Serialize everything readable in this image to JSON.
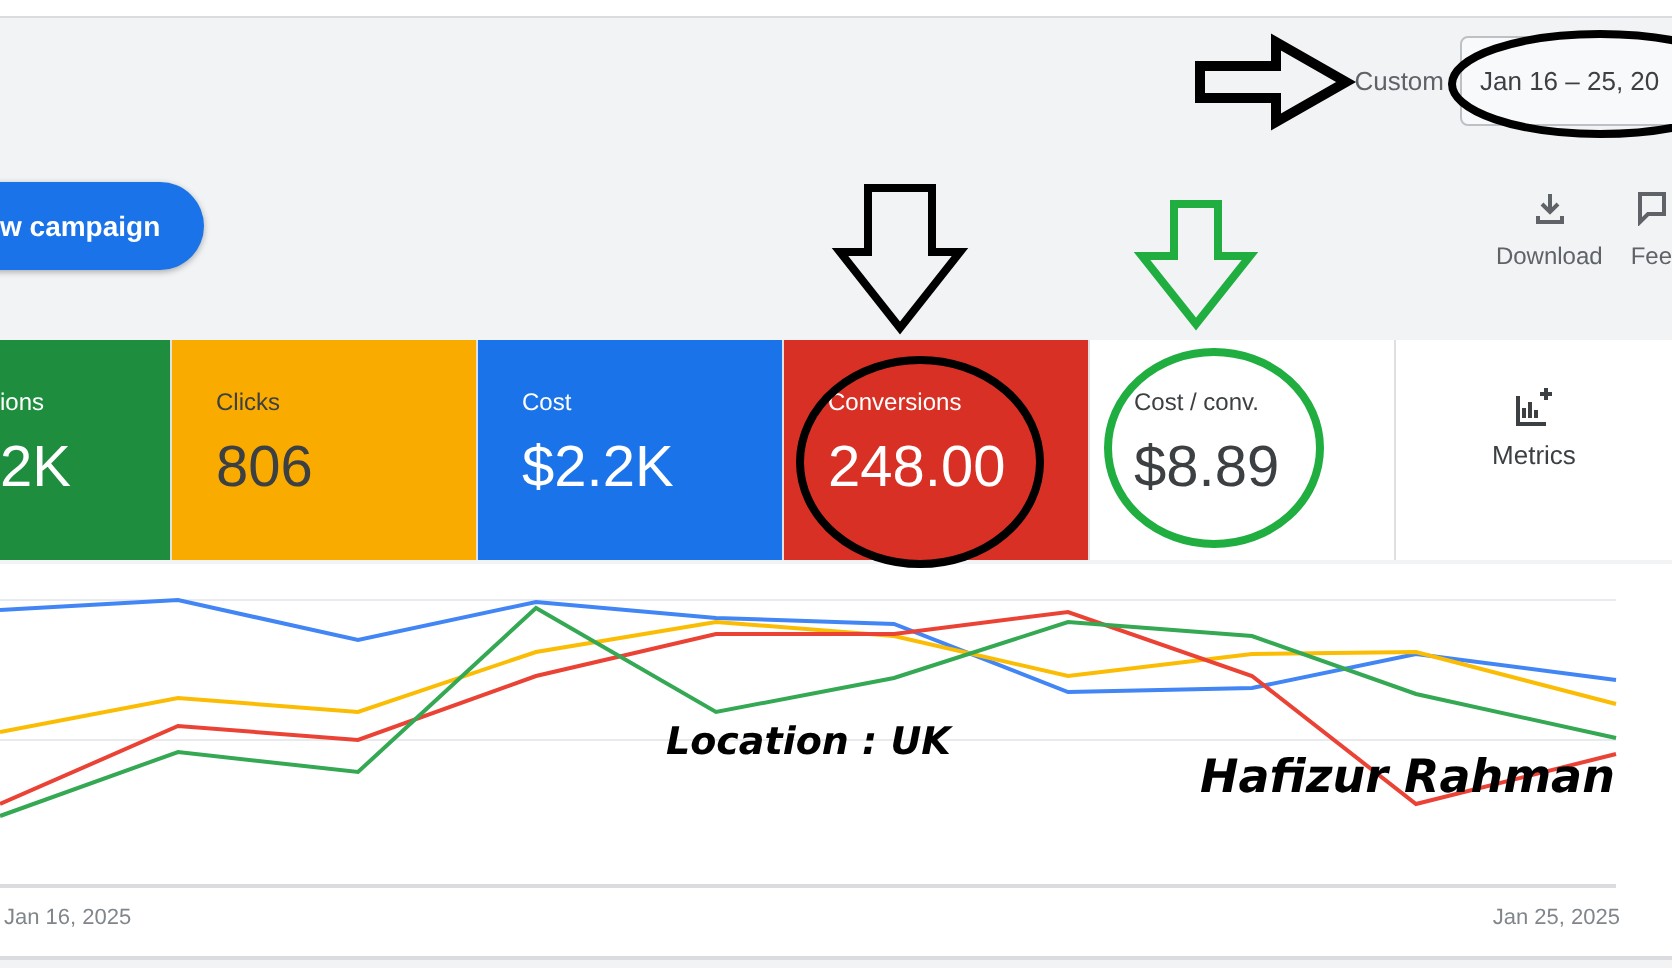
{
  "date_range": {
    "label": "Custom",
    "value": "Jan 16 – 25, 20"
  },
  "new_campaign_button": "w campaign",
  "tools": [
    {
      "kind": "download",
      "label": "Download"
    },
    {
      "kind": "feedback",
      "label": "Fee"
    }
  ],
  "metrics": [
    {
      "label": "ions",
      "value": "2K",
      "selected": true,
      "color": "#1e8e3e"
    },
    {
      "label": "Clicks",
      "value": "806",
      "selected": true,
      "color": "#f9ab00"
    },
    {
      "label": "Cost",
      "value": "$2.2K",
      "selected": true,
      "color": "#1a73e8"
    },
    {
      "label": "Conversions",
      "value": "248.00",
      "selected": true,
      "color": "#d93025"
    },
    {
      "label": "Cost / conv.",
      "value": "$8.89",
      "selected": false
    }
  ],
  "metrics_button": "Metrics",
  "chart": {
    "x_labels": [
      "Jan 16, 2025",
      "Jan 25, 2025"
    ]
  },
  "annotations": {
    "location_note": "Location : UK",
    "signature": "Hafizur Rahman"
  }
}
